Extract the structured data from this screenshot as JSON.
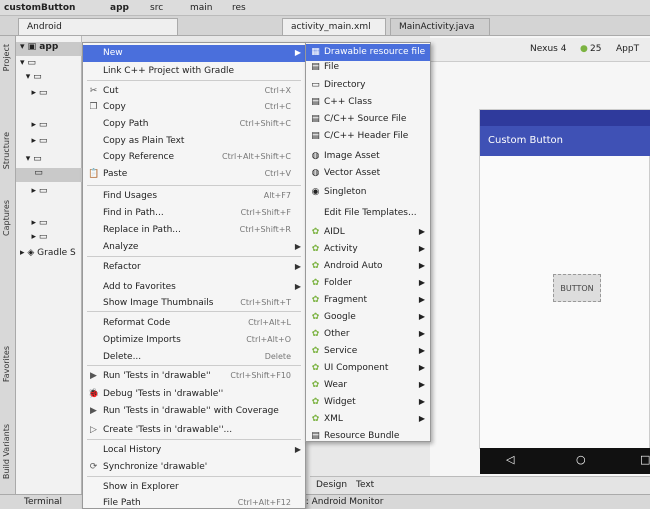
{
  "topbar": {
    "project": "customButton",
    "module": "app",
    "items": [
      "src",
      "main",
      "res"
    ]
  },
  "tabs": {
    "left": "Android",
    "editor": "activity_main.xml",
    "editor2": "MainActivity.java"
  },
  "toolstrip": {
    "project": "Project",
    "structure": "Structure",
    "captures": "Captures",
    "favorites": "Favorites",
    "build_variants": "Build Variants"
  },
  "tree": {
    "root": "app",
    "gradle": "Gradle S"
  },
  "design_toolbar": {
    "device": "Nexus 4",
    "api": "25",
    "theme": "AppT"
  },
  "phone": {
    "app_title": "Custom Button",
    "button_text": "BUTTON"
  },
  "design_tabs": {
    "design": "Design",
    "text": "Text"
  },
  "bottombar": {
    "terminal": "Terminal",
    "android_monitor": "6: Android Monitor"
  },
  "context_menu": {
    "items": [
      {
        "label": "New",
        "shortcut": "",
        "arrow": true,
        "icon": "",
        "highlighted": true
      },
      {
        "label": "Link C++ Project with Gradle",
        "shortcut": "",
        "arrow": false,
        "icon": ""
      },
      {
        "label": "Cut",
        "shortcut": "Ctrl+X",
        "arrow": false,
        "icon": "✂"
      },
      {
        "label": "Copy",
        "shortcut": "Ctrl+C",
        "arrow": false,
        "icon": "❐"
      },
      {
        "label": "Copy Path",
        "shortcut": "Ctrl+Shift+C",
        "arrow": false,
        "icon": ""
      },
      {
        "label": "Copy as Plain Text",
        "shortcut": "",
        "arrow": false,
        "icon": ""
      },
      {
        "label": "Copy Reference",
        "shortcut": "Ctrl+Alt+Shift+C",
        "arrow": false,
        "icon": ""
      },
      {
        "label": "Paste",
        "shortcut": "Ctrl+V",
        "arrow": false,
        "icon": "📋"
      },
      {
        "label": "Find Usages",
        "shortcut": "Alt+F7",
        "arrow": false,
        "icon": ""
      },
      {
        "label": "Find in Path...",
        "shortcut": "Ctrl+Shift+F",
        "arrow": false,
        "icon": ""
      },
      {
        "label": "Replace in Path...",
        "shortcut": "Ctrl+Shift+R",
        "arrow": false,
        "icon": ""
      },
      {
        "label": "Analyze",
        "shortcut": "",
        "arrow": true,
        "icon": ""
      },
      {
        "label": "Refactor",
        "shortcut": "",
        "arrow": true,
        "icon": ""
      },
      {
        "label": "Add to Favorites",
        "shortcut": "",
        "arrow": true,
        "icon": ""
      },
      {
        "label": "Show Image Thumbnails",
        "shortcut": "Ctrl+Shift+T",
        "arrow": false,
        "icon": ""
      },
      {
        "label": "Reformat Code",
        "shortcut": "Ctrl+Alt+L",
        "arrow": false,
        "icon": ""
      },
      {
        "label": "Optimize Imports",
        "shortcut": "Ctrl+Alt+O",
        "arrow": false,
        "icon": ""
      },
      {
        "label": "Delete...",
        "shortcut": "Delete",
        "arrow": false,
        "icon": ""
      },
      {
        "label": "Run 'Tests in 'drawable''",
        "shortcut": "Ctrl+Shift+F10",
        "arrow": false,
        "icon": "▶"
      },
      {
        "label": "Debug 'Tests in 'drawable''",
        "shortcut": "",
        "arrow": false,
        "icon": "🐞"
      },
      {
        "label": "Run 'Tests in 'drawable'' with Coverage",
        "shortcut": "",
        "arrow": false,
        "icon": "▶"
      },
      {
        "label": "Create 'Tests in 'drawable''...",
        "shortcut": "",
        "arrow": false,
        "icon": "▷"
      },
      {
        "label": "Local History",
        "shortcut": "",
        "arrow": true,
        "icon": ""
      },
      {
        "label": "Synchronize 'drawable'",
        "shortcut": "",
        "arrow": false,
        "icon": "⟳"
      },
      {
        "label": "Show in Explorer",
        "shortcut": "",
        "arrow": false,
        "icon": ""
      },
      {
        "label": "File Path",
        "shortcut": "Ctrl+Alt+F12",
        "arrow": false,
        "icon": ""
      }
    ]
  },
  "new_submenu": {
    "items": [
      {
        "label": "Drawable resource file",
        "arrow": false,
        "icon": "▦",
        "highlighted": true
      },
      {
        "label": "File",
        "arrow": false,
        "icon": "▤"
      },
      {
        "label": "Directory",
        "arrow": false,
        "icon": "▭"
      },
      {
        "label": "C++ Class",
        "arrow": false,
        "icon": "▤"
      },
      {
        "label": "C/C++ Source File",
        "arrow": false,
        "icon": "▤"
      },
      {
        "label": "C/C++ Header File",
        "arrow": false,
        "icon": "▤"
      },
      {
        "label": "Image Asset",
        "arrow": false,
        "icon": "◍"
      },
      {
        "label": "Vector Asset",
        "arrow": false,
        "icon": "◍"
      },
      {
        "label": "Singleton",
        "arrow": false,
        "icon": "◉"
      },
      {
        "label": "Edit File Templates...",
        "arrow": false,
        "icon": ""
      },
      {
        "label": "AIDL",
        "arrow": true,
        "icon": "✿"
      },
      {
        "label": "Activity",
        "arrow": true,
        "icon": "✿"
      },
      {
        "label": "Android Auto",
        "arrow": true,
        "icon": "✿"
      },
      {
        "label": "Folder",
        "arrow": true,
        "icon": "✿"
      },
      {
        "label": "Fragment",
        "arrow": true,
        "icon": "✿"
      },
      {
        "label": "Google",
        "arrow": true,
        "icon": "✿"
      },
      {
        "label": "Other",
        "arrow": true,
        "icon": "✿"
      },
      {
        "label": "Service",
        "arrow": true,
        "icon": "✿"
      },
      {
        "label": "UI Component",
        "arrow": true,
        "icon": "✿"
      },
      {
        "label": "Wear",
        "arrow": true,
        "icon": "✿"
      },
      {
        "label": "Widget",
        "arrow": true,
        "icon": "✿"
      },
      {
        "label": "XML",
        "arrow": true,
        "icon": "✿"
      },
      {
        "label": "Resource Bundle",
        "arrow": false,
        "icon": "▤"
      }
    ]
  },
  "colors": {
    "highlight": "#4a6fdc",
    "appbar": "#3f51b5",
    "android_green": "#7cb342"
  }
}
